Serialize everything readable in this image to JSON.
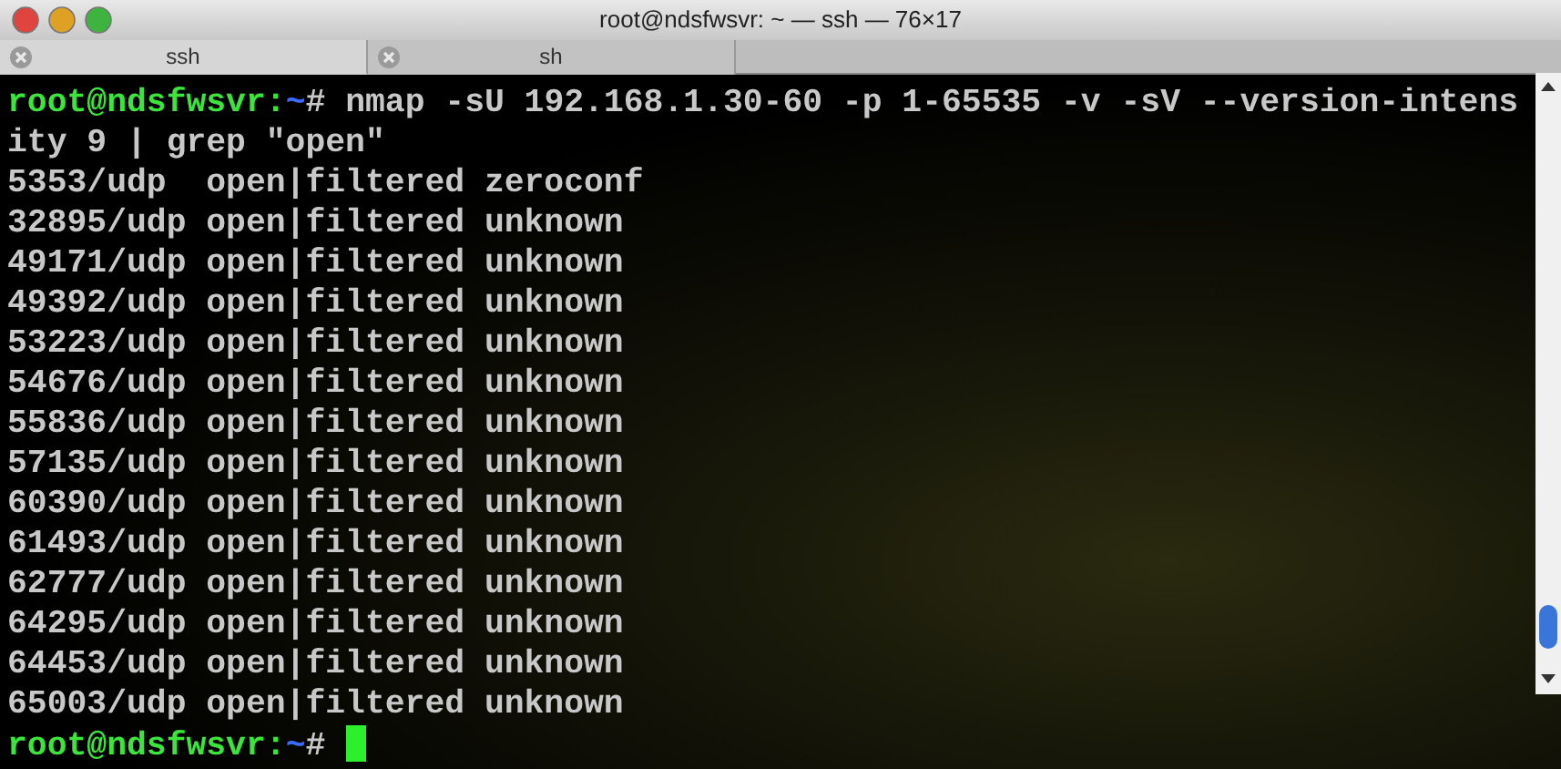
{
  "window": {
    "title": "root@ndsfwsvr: ~ — ssh — 76×17"
  },
  "tabs": [
    {
      "label": "ssh",
      "selected": true
    },
    {
      "label": "sh",
      "selected": false
    }
  ],
  "terminal": {
    "lines": [
      {
        "kind": "prompt",
        "prompt": "root@ndsfwsvr:",
        "path": "~",
        "symbol": "#",
        "command": "nmap -sU 192.168.1.30-60 -p 1-65535 -v -sV --version-intens",
        "cursor": false
      },
      {
        "kind": "output",
        "text": "ity 9 | grep \"open\""
      },
      {
        "kind": "output",
        "text": "5353/udp  open|filtered zeroconf"
      },
      {
        "kind": "output",
        "text": "32895/udp open|filtered unknown"
      },
      {
        "kind": "output",
        "text": "49171/udp open|filtered unknown"
      },
      {
        "kind": "output",
        "text": "49392/udp open|filtered unknown"
      },
      {
        "kind": "output",
        "text": "53223/udp open|filtered unknown"
      },
      {
        "kind": "output",
        "text": "54676/udp open|filtered unknown"
      },
      {
        "kind": "output",
        "text": "55836/udp open|filtered unknown"
      },
      {
        "kind": "output",
        "text": "57135/udp open|filtered unknown"
      },
      {
        "kind": "output",
        "text": "60390/udp open|filtered unknown"
      },
      {
        "kind": "output",
        "text": "61493/udp open|filtered unknown"
      },
      {
        "kind": "output",
        "text": "62777/udp open|filtered unknown"
      },
      {
        "kind": "output",
        "text": "64295/udp open|filtered unknown"
      },
      {
        "kind": "output",
        "text": "64453/udp open|filtered unknown"
      },
      {
        "kind": "output",
        "text": "65003/udp open|filtered unknown"
      },
      {
        "kind": "prompt",
        "prompt": "root@ndsfwsvr:",
        "path": "~",
        "symbol": "#",
        "cursor": true
      }
    ]
  }
}
